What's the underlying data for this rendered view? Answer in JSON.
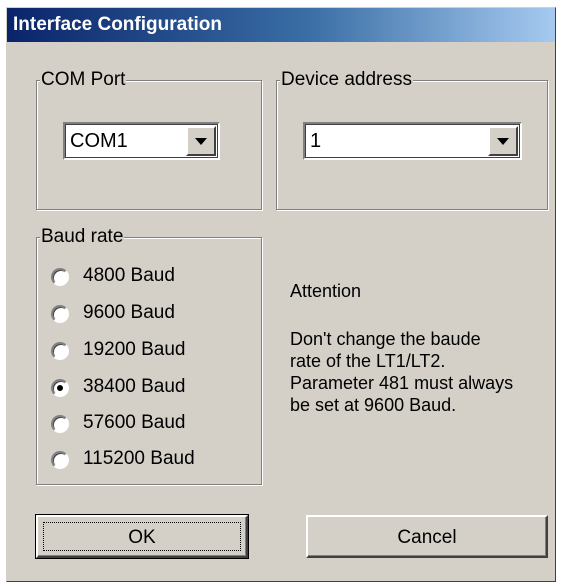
{
  "window": {
    "title": "Interface Configuration"
  },
  "com_port": {
    "legend": "COM Port",
    "value": "COM1"
  },
  "device_address": {
    "legend": "Device address",
    "value": "1"
  },
  "baud_rate": {
    "legend": "Baud rate",
    "options": [
      "4800 Baud",
      "9600 Baud",
      "19200 Baud",
      "38400 Baud",
      "57600 Baud",
      "115200 Baud"
    ],
    "selected": "38400 Baud"
  },
  "notice": {
    "heading": "Attention",
    "line1": "Don't change the baude",
    "line2": "rate of the LT1/LT2.",
    "line3": "Parameter 481 must always",
    "line4": "be set at 9600 Baud."
  },
  "buttons": {
    "ok": "OK",
    "cancel": "Cancel"
  }
}
